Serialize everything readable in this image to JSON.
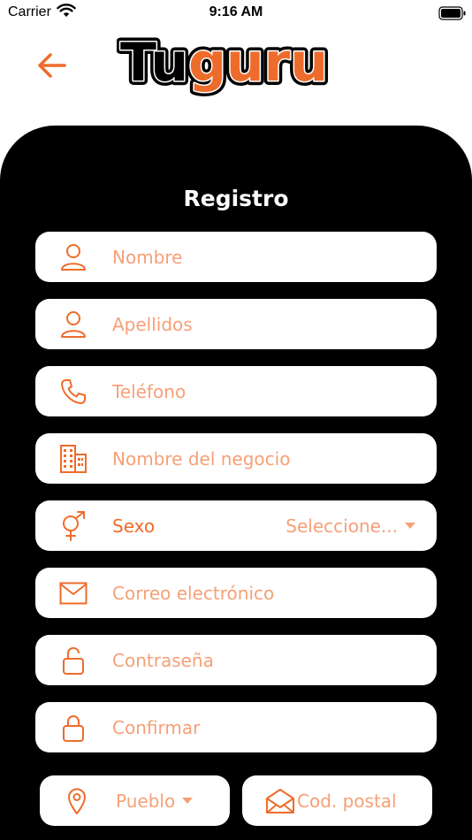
{
  "status_bar": {
    "carrier": "Carrier",
    "time": "9:16 AM"
  },
  "header": {
    "logo_text": "Tuguru",
    "logo_part1": "Tu",
    "logo_part2": "guru"
  },
  "form": {
    "title": "Registro",
    "fields": [
      {
        "icon": "person-icon",
        "placeholder": "Nombre"
      },
      {
        "icon": "person-icon",
        "placeholder": "Apellidos"
      },
      {
        "icon": "phone-icon",
        "placeholder": "Teléfono"
      },
      {
        "icon": "building-icon",
        "placeholder": "Nombre del negocio"
      },
      {
        "icon": "gender-icon",
        "label": "Sexo",
        "select_value": "Seleccione..."
      },
      {
        "icon": "mail-icon",
        "placeholder": "Correo electrónico"
      },
      {
        "icon": "unlock-icon",
        "placeholder": "Contraseña"
      },
      {
        "icon": "lock-icon",
        "placeholder": "Confirmar"
      }
    ],
    "town": {
      "icon": "location-pin-icon",
      "value": "Pueblo"
    },
    "postal": {
      "icon": "envelope-open-icon",
      "placeholder": "Cod. postal"
    }
  },
  "colors": {
    "accent": "#EE6C2B",
    "placeholder": "#F6A077",
    "panel": "#000000",
    "background": "#FFFFFF"
  }
}
